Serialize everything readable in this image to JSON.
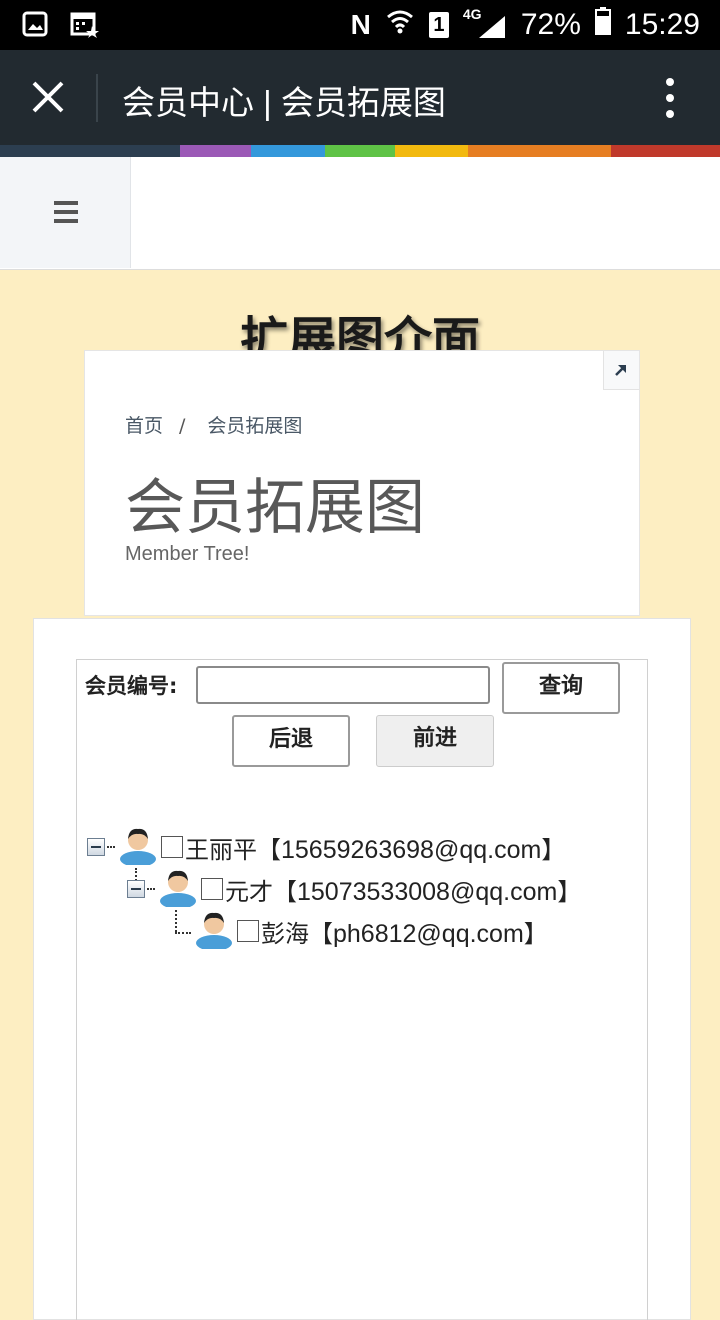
{
  "status_bar": {
    "carrier_icons": [
      "gallery-icon",
      "calendar-icon"
    ],
    "right_icons": [
      "nfc-icon",
      "wifi-icon",
      "sim-icon",
      "signal-icon",
      "battery-icon"
    ],
    "network": "4G",
    "sim": "1",
    "nfc": "N",
    "battery": "72%",
    "time": "15:29"
  },
  "titlebar": {
    "title": "会员中心 | 会员拓展图"
  },
  "colors": {
    "titlebar_bg": "#222a30",
    "page_bg": "#fdeec2",
    "stripe": [
      "#2c3e50",
      "#9b59b6",
      "#3498db",
      "#5fc346",
      "#f2b90f",
      "#e67e22",
      "#c0392b"
    ]
  },
  "heading": "扩展图介面",
  "card": {
    "breadcrumb": [
      "首页",
      "会员拓展图"
    ],
    "breadcrumb_sep": "/",
    "title": "会员拓展图",
    "subtitle": "Member Tree!"
  },
  "search": {
    "label": "会员编号:",
    "value": "",
    "query_label": "查询",
    "back_label": "后退",
    "forward_label": "前进"
  },
  "tree": [
    {
      "level": 0,
      "name": "王丽平",
      "email": "15659263698@qq.com",
      "expanded": true
    },
    {
      "level": 1,
      "name": "元才",
      "email": "15073533008@qq.com",
      "expanded": true
    },
    {
      "level": 2,
      "name": "彭海",
      "email": "ph6812@qq.com",
      "expanded": false
    }
  ]
}
